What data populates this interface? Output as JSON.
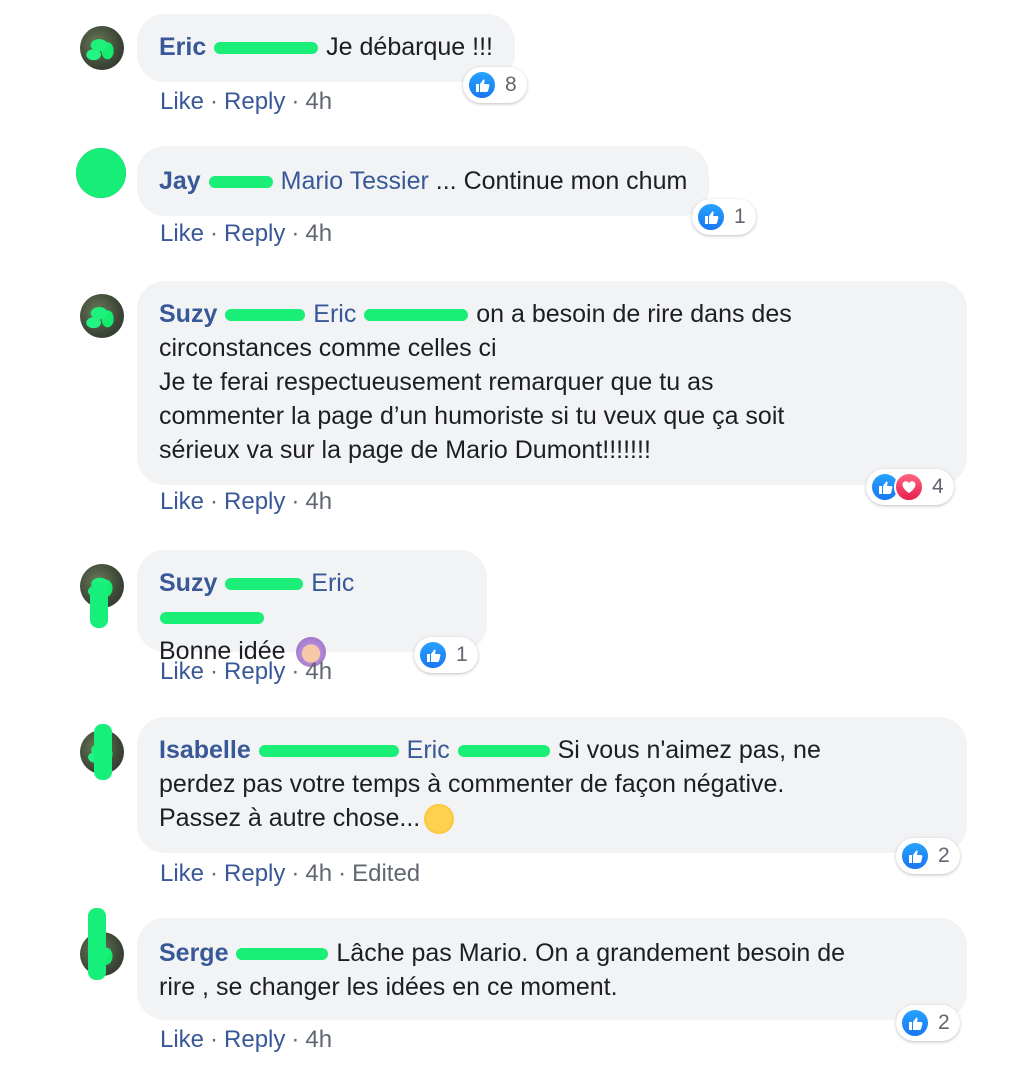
{
  "comments": [
    {
      "author": "Eric",
      "mention": "",
      "lines": [
        "Je débarque !!!"
      ],
      "reaction_count": "8",
      "reactions": [
        "like-icon"
      ],
      "like": "Like",
      "reply": "Reply",
      "time": "4h",
      "edited": ""
    },
    {
      "author": "Jay",
      "mention": "Mario Tessier",
      "lines": [
        "... Continue mon chum"
      ],
      "reaction_count": "1",
      "reactions": [
        "like-icon"
      ],
      "like": "Like",
      "reply": "Reply",
      "time": "4h",
      "edited": ""
    },
    {
      "author": "Suzy",
      "mention": "Eric",
      "lines": [
        "on a besoin de rire dans des",
        "circonstances comme celles ci",
        "Je te ferai respectueusement remarquer que tu as",
        "commenter la page d’un humoriste si tu veux que ça soit",
        "sérieux va sur la page de Mario Dumont!!!!!!!"
      ],
      "reaction_count": "4",
      "reactions": [
        "like-icon",
        "heart-icon"
      ],
      "like": "Like",
      "reply": "Reply",
      "time": "4h",
      "edited": ""
    },
    {
      "author": "Suzy",
      "mention": "Eric",
      "lines": [
        "Bonne idée"
      ],
      "reaction_count": "1",
      "reactions": [
        "like-icon"
      ],
      "like": "Like",
      "reply": "Reply",
      "time": "4h",
      "edited": ""
    },
    {
      "author": "Isabelle",
      "mention": "Eric",
      "lines": [
        "Si vous n'aimez pas, ne",
        "perdez pas votre temps à commenter de façon négative.",
        "Passez à autre chose..."
      ],
      "reaction_count": "2",
      "reactions": [
        "like-icon"
      ],
      "like": "Like",
      "reply": "Reply",
      "time": "4h",
      "edited": "Edited"
    },
    {
      "author": "Serge",
      "mention": "",
      "lines": [
        "Lâche pas Mario. On a grandement besoin de",
        "rire , se changer les idées en ce moment."
      ],
      "reaction_count": "2",
      "reactions": [
        "like-icon"
      ],
      "like": "Like",
      "reply": "Reply",
      "time": "4h",
      "edited": ""
    }
  ],
  "colors": {
    "author": "#385898",
    "bubble": "#f2f3f5",
    "meta": "#606770",
    "like_blue": "#1877f2",
    "love_red": "#e61e4d",
    "redaction_green": "#19ee76"
  }
}
